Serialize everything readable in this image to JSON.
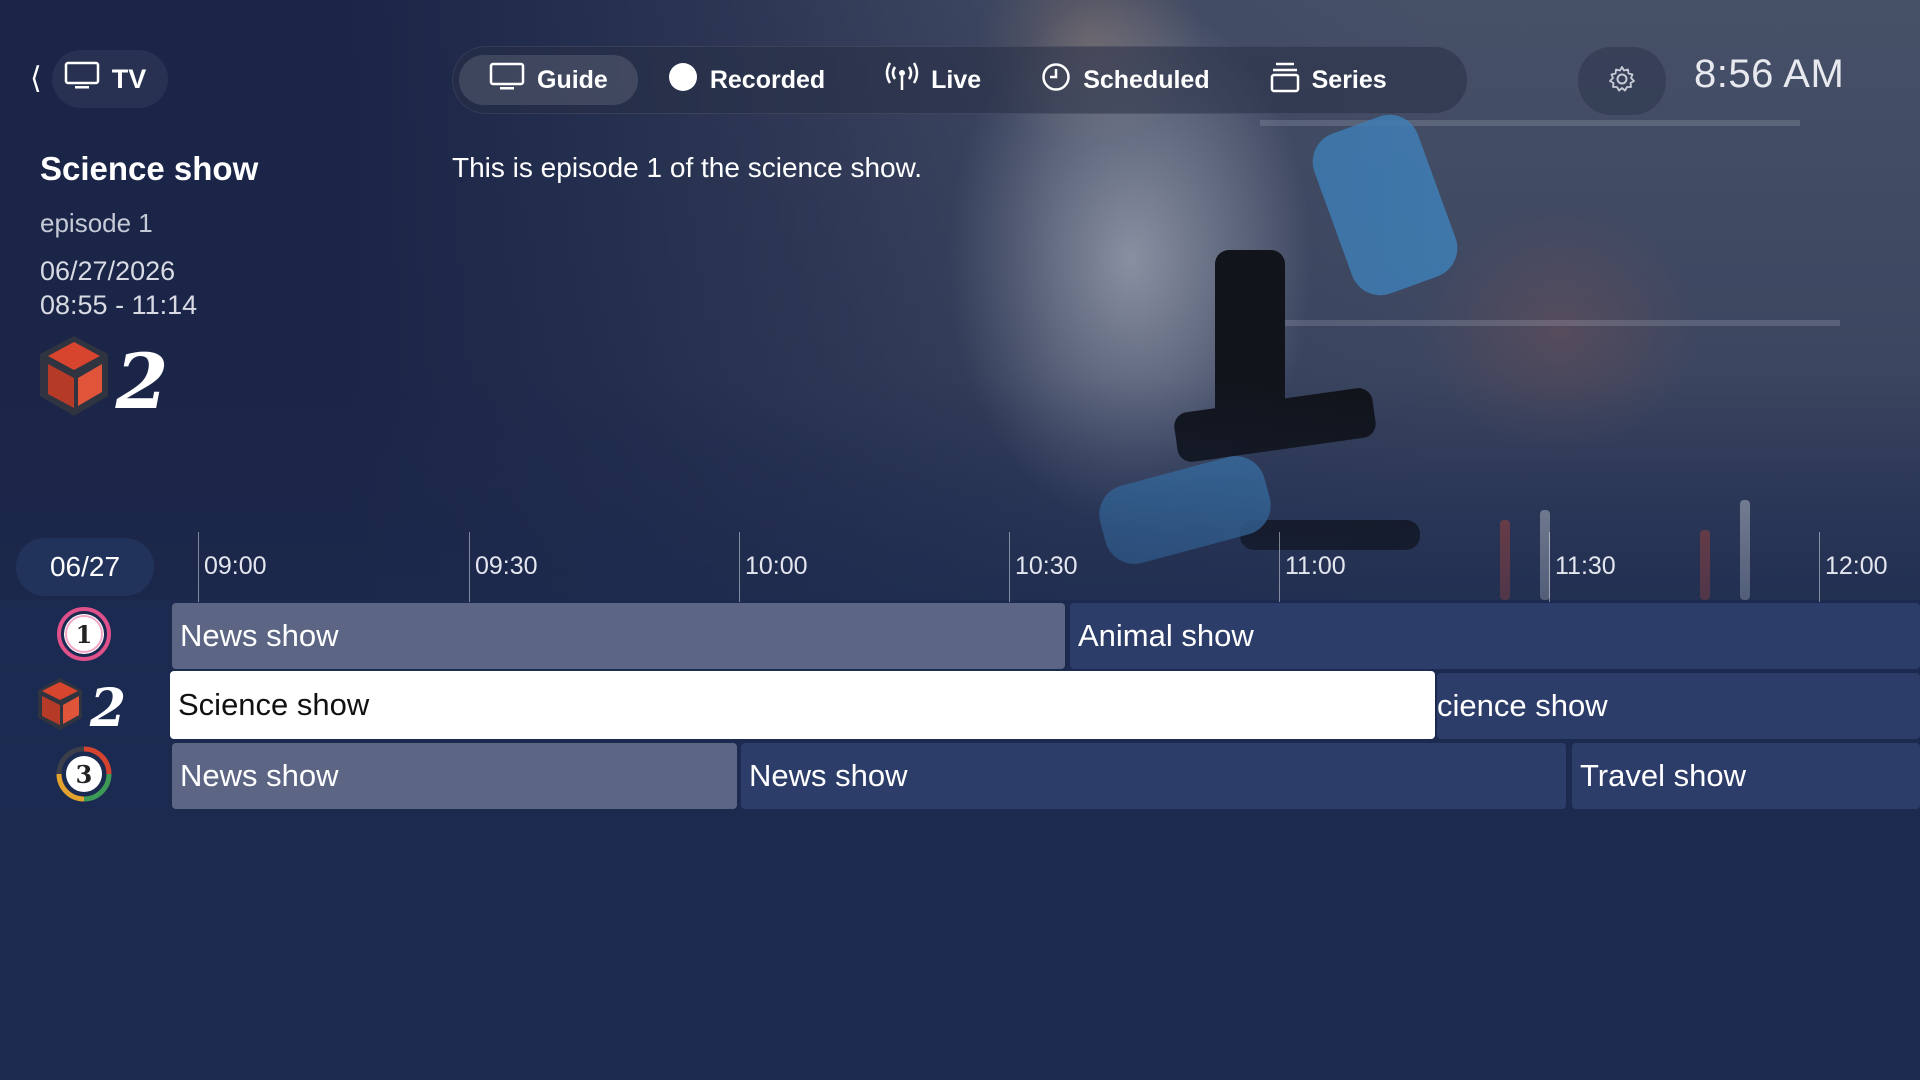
{
  "header": {
    "back_label": "TV",
    "clock": "8:56 AM",
    "tabs": [
      {
        "label": "Guide",
        "icon": "monitor-icon",
        "active": true
      },
      {
        "label": "Recorded",
        "icon": "record-dot-icon",
        "active": false
      },
      {
        "label": "Live",
        "icon": "broadcast-icon",
        "active": false
      },
      {
        "label": "Scheduled",
        "icon": "clock-icon",
        "active": false
      },
      {
        "label": "Series",
        "icon": "stack-icon",
        "active": false
      }
    ]
  },
  "program": {
    "title": "Science show",
    "episode": "episode 1",
    "date": "06/27/2026",
    "time": "08:55 - 11:14",
    "description": "This is episode 1 of the science show.",
    "channel_logo": "2"
  },
  "timeline": {
    "date": "06/27",
    "ticks": [
      "09:00",
      "09:30",
      "10:00",
      "10:30",
      "11:00",
      "11:30",
      "12:00"
    ]
  },
  "channels": [
    {
      "logo": "1",
      "programs": [
        {
          "title": "News show",
          "state": "past"
        },
        {
          "title": "Animal show",
          "state": "future"
        }
      ]
    },
    {
      "logo": "2",
      "programs": [
        {
          "title": "Science show",
          "state": "focused"
        },
        {
          "title": "cience show",
          "state": "future"
        }
      ]
    },
    {
      "logo": "3",
      "programs": [
        {
          "title": "News show",
          "state": "past"
        },
        {
          "title": "News show",
          "state": "future"
        },
        {
          "title": "Travel show",
          "state": "future"
        }
      ]
    }
  ],
  "colors": {
    "background": "#1c2a4f",
    "row_past": "#5c6684",
    "row_future": "#2d3d6a",
    "focused": "#ffffff"
  }
}
